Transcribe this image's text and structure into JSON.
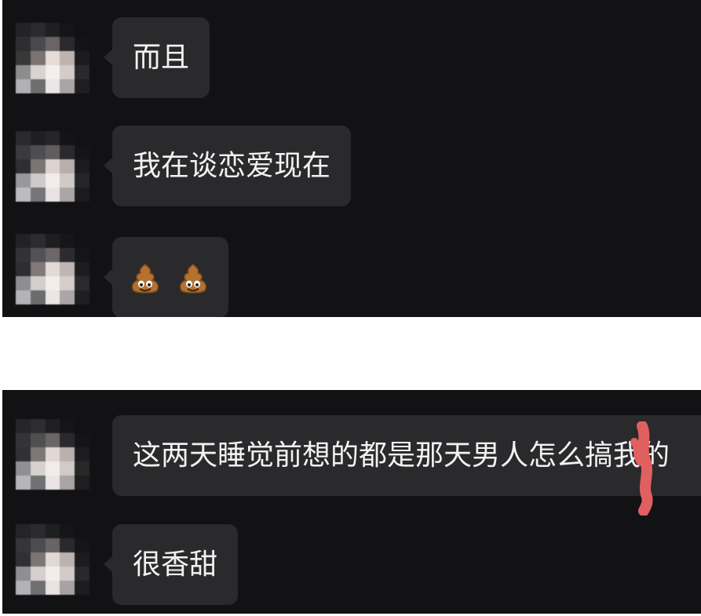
{
  "chat_top": {
    "messages": [
      {
        "text": "而且"
      },
      {
        "text": "我在谈恋爱现在"
      },
      {
        "emoji": [
          "poop-emoji",
          "poop-emoji"
        ]
      }
    ]
  },
  "chat_bottom": {
    "messages": [
      {
        "text": "这两天睡觉前想的都是那天男人怎么搞我的"
      },
      {
        "text": "很香甜"
      }
    ]
  },
  "colors": {
    "background": "#121214",
    "bubble": "#2a2a2c",
    "text": "#f2f2f2",
    "redaction": "#e06060"
  }
}
